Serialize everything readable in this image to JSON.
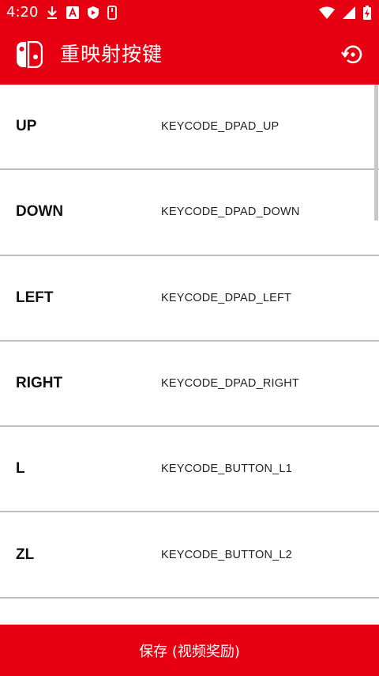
{
  "status_bar": {
    "time": "4:20",
    "left_icons": [
      "download-icon",
      "a-notification-icon",
      "shield-icon",
      "phone-icon"
    ],
    "right_icons": [
      "wifi-icon",
      "signal-icon",
      "battery-charging-icon"
    ]
  },
  "app_bar": {
    "title": "重映射按键",
    "logo_icon": "switch-logo-icon",
    "action_icon": "restore-icon",
    "background": "#e60012"
  },
  "mappings": [
    {
      "button": "UP",
      "keycode": "KEYCODE_DPAD_UP"
    },
    {
      "button": "DOWN",
      "keycode": "KEYCODE_DPAD_DOWN"
    },
    {
      "button": "LEFT",
      "keycode": "KEYCODE_DPAD_LEFT"
    },
    {
      "button": "RIGHT",
      "keycode": "KEYCODE_DPAD_RIGHT"
    },
    {
      "button": "L",
      "keycode": "KEYCODE_BUTTON_L1"
    },
    {
      "button": "ZL",
      "keycode": "KEYCODE_BUTTON_L2"
    },
    {
      "button": "",
      "keycode": ""
    }
  ],
  "footer": {
    "save_label": "保存 (视频奖励)"
  },
  "colors": {
    "accent": "#e60012",
    "divider": "#bdbdbd",
    "text": "#111111"
  }
}
